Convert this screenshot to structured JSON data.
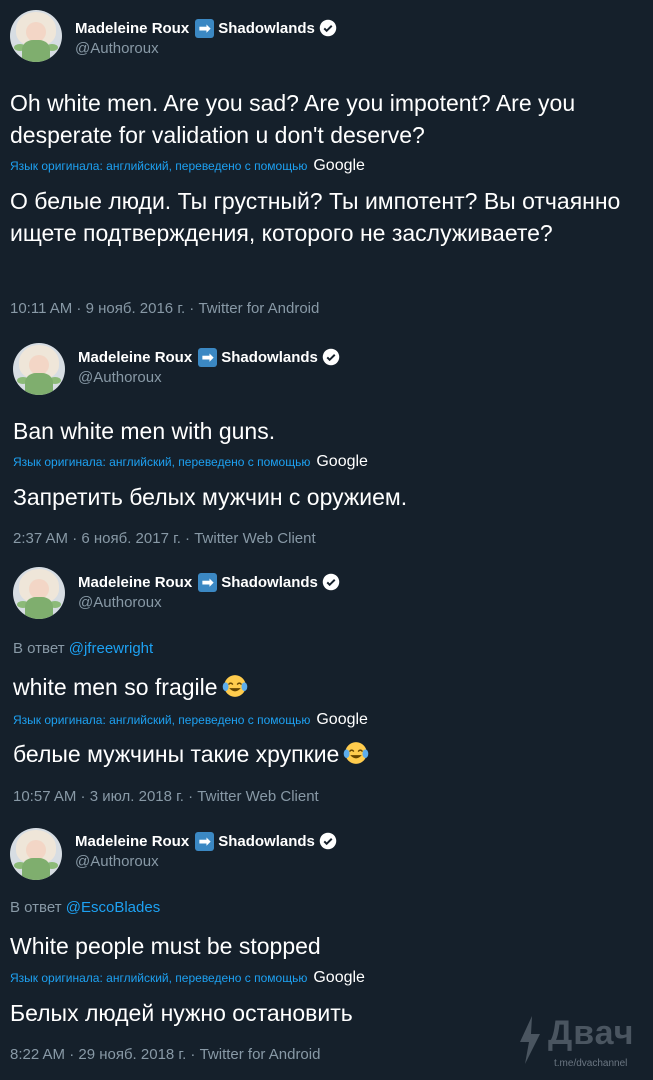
{
  "author": {
    "name": "Madeleine Roux",
    "arrow_icon": "right-arrow-emoji-icon",
    "suffix": "Shadowlands",
    "handle": "@Authoroux"
  },
  "translate": {
    "note": "Язык оригинала: английский, переведено с помощью",
    "brand": "Google"
  },
  "reply_prefix": "В ответ",
  "tweets": [
    {
      "text": "Oh white men. Are you sad? Are you impotent? Are you desperate for validation u don't deserve?",
      "translation": "О белые люди. Ты грустный? Ты импотент? Вы отчаянно ищете подтверждения, которого не заслуживаете?",
      "meta": "10:11 AM · 9 нояб. 2016 г. · Twitter for Android"
    },
    {
      "text": "Ban white men with guns.",
      "translation": "Запретить белых мужчин с оружием.",
      "meta": "2:37 AM · 6 нояб. 2017 г. · Twitter Web Client"
    },
    {
      "reply_mention": "@jfreewright",
      "text": "white men so fragile",
      "translation": "белые мужчины такие хрупкие",
      "meta": "10:57 AM · 3 июл. 2018 г. · Twitter Web Client"
    },
    {
      "reply_mention": "@EscoBlades",
      "text": "White people must be stopped",
      "translation": "Белых людей нужно остановить",
      "meta": "8:22 AM · 29 нояб. 2018 г. · Twitter for Android"
    }
  ],
  "watermark": {
    "title": "Двач",
    "subtitle": "t.me/dvachannel"
  },
  "colors": {
    "background": "#15202b",
    "text": "#ffffff",
    "secondary": "#8899a6",
    "link": "#1da1f2"
  }
}
